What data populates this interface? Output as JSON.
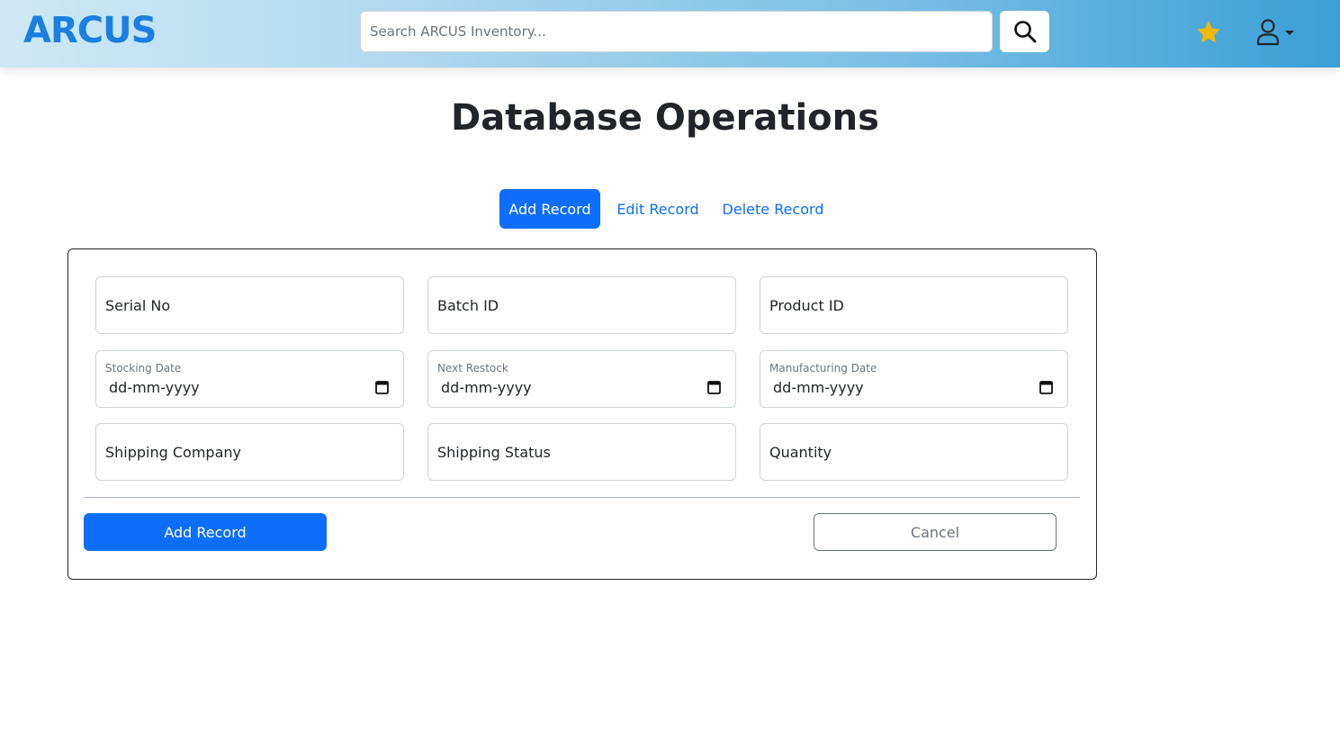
{
  "header": {
    "logo_text": "ARCUS",
    "search_placeholder": "Search ARCUS Inventory...",
    "search_icon": "search-icon",
    "favorites_icon": "star-icon",
    "user_icon": "user-icon",
    "colors": {
      "gradient_start": "#cfe8f5",
      "gradient_end": "#3a9fd6",
      "logo": "#1a7fe0",
      "star": "#f5b800"
    }
  },
  "page": {
    "title": "Database Operations"
  },
  "tabs": [
    {
      "label": "Add Record",
      "active": true
    },
    {
      "label": "Edit Record",
      "active": false
    },
    {
      "label": "Delete Record",
      "active": false
    }
  ],
  "form": {
    "fields": {
      "serial_no": {
        "label": "Serial No"
      },
      "batch_id": {
        "label": "Batch ID"
      },
      "product_id": {
        "label": "Product ID"
      },
      "stocking_date": {
        "label": "Stocking Date",
        "value": "dd-mm-yyyy"
      },
      "next_restock": {
        "label": "Next Restock",
        "value": "dd-mm-yyyy"
      },
      "manufacturing_date": {
        "label": "Manufacturing Date",
        "value": "dd-mm-yyyy"
      },
      "shipping_company": {
        "label": "Shipping Company"
      },
      "shipping_status": {
        "label": "Shipping Status"
      },
      "quantity": {
        "label": "Quantity"
      }
    },
    "submit_label": "Add Record",
    "cancel_label": "Cancel"
  },
  "colors": {
    "primary": "#0d6efd",
    "text": "#212529",
    "muted": "#6c757d",
    "border": "#ced4da"
  }
}
